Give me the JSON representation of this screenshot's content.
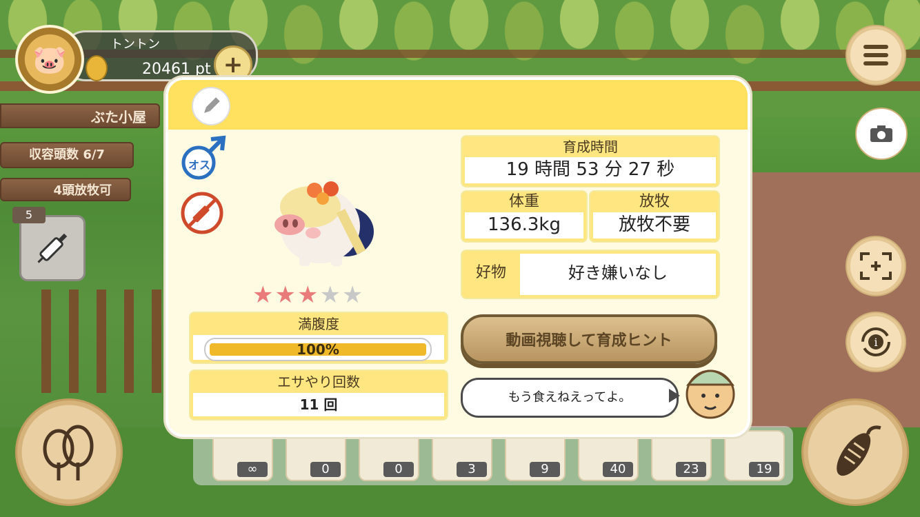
{
  "player": {
    "name": "トントン",
    "points": "20461 pt"
  },
  "left_panel": {
    "hut_label": "ぶた小屋",
    "capacity": "収容頭数 6/7",
    "grazing_ok": "4頭放牧可",
    "syringe_count": "5"
  },
  "pig_detail": {
    "sex": "オス",
    "rating": {
      "filled": 3,
      "max": 5
    },
    "stars_filled": "★★★",
    "stars_empty": "★★",
    "hunger": {
      "label": "満腹度",
      "value": "100%",
      "level": 1.0
    },
    "feed_count": {
      "label": "エサやり回数",
      "value": "11 回"
    },
    "raise_time": {
      "label": "育成時間",
      "value": "19 時間 53 分 27 秒"
    },
    "weight": {
      "label": "体重",
      "value": "136.3kg"
    },
    "grazing": {
      "label": "放牧",
      "value": "放牧不要"
    },
    "favorite": {
      "label": "好物",
      "value": "好き嫌いなし"
    },
    "hint_button": "動画視聴して育成ヒント",
    "farmer_speech": "もう食えねえってよ。"
  },
  "food_bar": [
    {
      "name": "rice",
      "count": "∞"
    },
    {
      "name": "beans",
      "count": "0"
    },
    {
      "name": "sweet-potato",
      "count": "0"
    },
    {
      "name": "corn",
      "count": "3"
    },
    {
      "name": "peanuts",
      "count": "9"
    },
    {
      "name": "acorns",
      "count": "40"
    },
    {
      "name": "mixed-feed",
      "count": "23"
    },
    {
      "name": "truffle",
      "count": "19"
    }
  ],
  "colors": {
    "header": "#ffe05f",
    "star_on": "#e97b7b",
    "star_off": "#c8c8c8",
    "hunger_fill": "#f0b929"
  }
}
